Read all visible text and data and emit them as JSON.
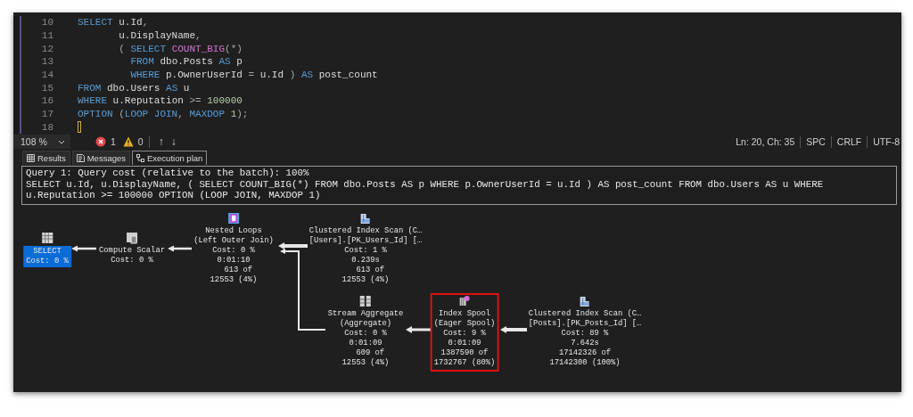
{
  "editor": {
    "lines": [
      {
        "number": "10",
        "cursor": false,
        "tokens": [
          {
            "kind": "keyword",
            "text": "SELECT"
          },
          {
            "kind": "ident",
            "text": " u.Id"
          },
          {
            "kind": "punct",
            "text": ","
          }
        ]
      },
      {
        "number": "11",
        "cursor": false,
        "tokens": [
          {
            "kind": "ident",
            "text": "       u.DisplayName"
          },
          {
            "kind": "punct",
            "text": ","
          }
        ]
      },
      {
        "number": "12",
        "cursor": false,
        "tokens": [
          {
            "kind": "punct",
            "text": "       ( "
          },
          {
            "kind": "keyword",
            "text": "SELECT "
          },
          {
            "kind": "function",
            "text": "COUNT_BIG"
          },
          {
            "kind": "punct",
            "text": "(*)"
          }
        ]
      },
      {
        "number": "13",
        "cursor": false,
        "tokens": [
          {
            "kind": "keyword",
            "text": "         FROM"
          },
          {
            "kind": "ident",
            "text": " dbo.Posts "
          },
          {
            "kind": "keyword",
            "text": "AS"
          },
          {
            "kind": "ident",
            "text": " p"
          }
        ]
      },
      {
        "number": "14",
        "cursor": false,
        "tokens": [
          {
            "kind": "keyword",
            "text": "         WHERE"
          },
          {
            "kind": "ident",
            "text": " p.OwnerUserId "
          },
          {
            "kind": "punct",
            "text": "="
          },
          {
            "kind": "ident",
            "text": " u.Id "
          },
          {
            "kind": "punct",
            "text": ") "
          },
          {
            "kind": "keyword",
            "text": "AS"
          },
          {
            "kind": "ident",
            "text": " post_count"
          }
        ]
      },
      {
        "number": "15",
        "cursor": false,
        "tokens": [
          {
            "kind": "keyword",
            "text": "FROM"
          },
          {
            "kind": "ident",
            "text": " dbo.Users "
          },
          {
            "kind": "keyword",
            "text": "AS"
          },
          {
            "kind": "ident",
            "text": " u"
          }
        ]
      },
      {
        "number": "16",
        "cursor": false,
        "tokens": [
          {
            "kind": "keyword",
            "text": "WHERE"
          },
          {
            "kind": "ident",
            "text": " u.Reputation "
          },
          {
            "kind": "punct",
            "text": ">= "
          },
          {
            "kind": "number",
            "text": "100000"
          }
        ]
      },
      {
        "number": "17",
        "cursor": false,
        "tokens": [
          {
            "kind": "keyword",
            "text": "OPTION"
          },
          {
            "kind": "punct",
            "text": " ("
          },
          {
            "kind": "keyword",
            "text": "LOOP JOIN"
          },
          {
            "kind": "punct",
            "text": ", "
          },
          {
            "kind": "keyword",
            "text": "MAXDOP"
          },
          {
            "kind": "number",
            "text": " 1"
          },
          {
            "kind": "punct",
            "text": ");"
          }
        ]
      },
      {
        "number": "18",
        "cursor": true
      }
    ]
  },
  "status_bar": {
    "zoom": "108 %",
    "errors": "1",
    "warnings": "0",
    "nav": [
      "↑",
      "↓"
    ],
    "items": [
      "Ln: 20, Ch: 35",
      "SPC",
      "CRLF",
      "UTF-8"
    ]
  },
  "tabs": [
    {
      "label": "Results",
      "kind": "grid",
      "selected": false
    },
    {
      "label": "Messages",
      "kind": "messages",
      "selected": false
    },
    {
      "label": "Execution plan",
      "kind": "plan",
      "selected": true
    }
  ],
  "query": {
    "lines": [
      "Query 1: Query cost (relative to the batch): 100%",
      "SELECT u.Id, u.DisplayName, ( SELECT COUNT_BIG(*) FROM dbo.Posts AS p WHERE p.OwnerUserId = u.Id ) AS post_count FROM dbo.Users AS u WHERE",
      "u.Reputation >= 100000 OPTION (LOOP JOIN, MAXDOP 1)"
    ]
  },
  "plan": {
    "nodes": [
      {
        "kind": "select",
        "selected": true,
        "highlighted": false,
        "lines": [
          "SELECT",
          "Cost: 0 %"
        ]
      },
      {
        "kind": "compute",
        "selected": false,
        "highlighted": false,
        "lines": [
          "Compute Scalar",
          "Cost: 0 %"
        ]
      },
      {
        "kind": "loops",
        "selected": false,
        "highlighted": false,
        "lines": [
          "Nested Loops",
          "(Left Outer Join)",
          "Cost: 0 %",
          "0:01:10",
          "  613 of",
          "12553 (4%)"
        ]
      },
      {
        "kind": "scan",
        "selected": false,
        "highlighted": false,
        "lines": [
          "Clustered Index Scan (C…",
          "[Users].[PK_Users_Id] […",
          "Cost: 1 %",
          "0.239s",
          "  613 of",
          "12553 (4%)"
        ]
      },
      {
        "kind": "aggregate",
        "selected": false,
        "highlighted": false,
        "lines": [
          "Stream Aggregate",
          "(Aggregate)",
          "Cost: 0 %",
          "0:01:09",
          "  609 of",
          "12553 (4%)"
        ]
      },
      {
        "kind": "spool",
        "selected": false,
        "highlighted": true,
        "lines": [
          "Index Spool",
          "(Eager Spool)",
          "Cost: 9 %",
          "0:01:09",
          "1387590 of",
          "1732767 (80%)"
        ]
      },
      {
        "kind": "scan",
        "selected": false,
        "highlighted": false,
        "lines": [
          "Clustered Index Scan (C…",
          "[Posts].[PK_Posts_Id] […",
          "Cost: 89 %",
          "7.642s",
          "17142326 of",
          "17142300 (100%)"
        ]
      }
    ]
  }
}
